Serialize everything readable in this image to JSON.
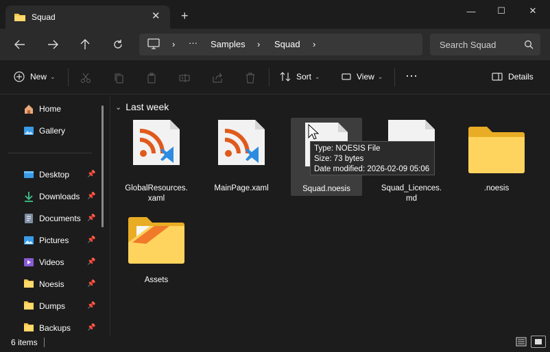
{
  "window": {
    "tab_title": "Squad"
  },
  "address": {
    "ellipsis": "···",
    "crumbs": [
      "Samples",
      "Squad"
    ]
  },
  "search": {
    "placeholder": "Search Squad"
  },
  "toolbar": {
    "new_label": "New",
    "sort_label": "Sort",
    "view_label": "View",
    "more_label": "···",
    "details_label": "Details"
  },
  "sidebar": {
    "top_items": [
      "Home",
      "Gallery"
    ],
    "pinned_items": [
      "Desktop",
      "Downloads",
      "Documents",
      "Pictures",
      "Videos",
      "Noesis",
      "Dumps",
      "Backups"
    ]
  },
  "main": {
    "group_title": "Last week",
    "files": [
      {
        "name": "GlobalResources.xaml",
        "line1": "GlobalResources.",
        "line2": "xaml",
        "type": "xaml"
      },
      {
        "name": "MainPage.xaml",
        "line1": "MainPage.xaml",
        "line2": "",
        "type": "xaml"
      },
      {
        "name": "Squad.noesis",
        "line1": "Squad.noesis",
        "line2": "",
        "type": "blank"
      },
      {
        "name": "Squad_Licences.md",
        "line1": "Squad_Licences.",
        "line2": "md",
        "type": "md"
      },
      {
        "name": ".noesis",
        "line1": ".noesis",
        "line2": "",
        "type": "folder"
      },
      {
        "name": "Assets",
        "line1": "Assets",
        "line2": "",
        "type": "folder-assets"
      }
    ]
  },
  "tooltip": {
    "type_line": "Type: NOESIS File",
    "size_line": "Size: 73 bytes",
    "date_line": "Date modified: 2026-02-09 05:06"
  },
  "status": {
    "item_count": "6 items"
  },
  "colors": {
    "folder": "#f4c54b",
    "accent": "#4aa0e6",
    "rss": "#e05a1c"
  }
}
